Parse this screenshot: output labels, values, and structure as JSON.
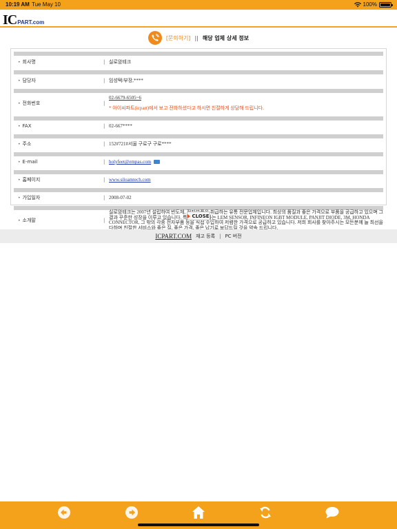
{
  "status_bar": {
    "time": "10:19 AM",
    "date": "Tue May 10",
    "battery": "100%"
  },
  "header": {
    "logo_main": "IC",
    "logo_sub": "PART.com"
  },
  "title": {
    "link": "[문의하기]",
    "separator": "||",
    "main": "해당 업체 상세 정보"
  },
  "info": {
    "company": {
      "label": "회사명",
      "value": "실로암테크"
    },
    "manager": {
      "label": "담당자",
      "value": "임성택/부장,****"
    },
    "phone": {
      "label": "전화번호",
      "value": "02-6679-6505~6",
      "notice": "* 아이씨파트(icpart)에서 보고 전화하셨다고 하시면 친절하게 상담해 드립니다."
    },
    "fax": {
      "label": "FAX",
      "value": "02-667****"
    },
    "address": {
      "label": "주소",
      "value": "152#721#서울 구로구 구로****"
    },
    "email": {
      "label": "E-mail",
      "value": "holyfeet@empas.com"
    },
    "homepage": {
      "label": "홈페이지",
      "value": "www.siloamtech.com"
    },
    "joined": {
      "label": "가입일자",
      "value": "2008-07-02"
    },
    "intro": {
      "label": "소개말",
      "value": "실로암테크는 2007년 설립하여 반도체, 전자부품을 취급하는 유통 전문업체입니다. 최상의 품질과 좋은 가격으로 부품을 공급하고 있으며 그 결과 꾸준한 성장을 이루고 있습니다. 특히 저희 회사는 LEM SENSOR, INFINEON IGBT MODULE, PANJIT DIODE, 3M, HONDA CONNECTOR, 그 밖의 각종 전자부품 등을 직접 수입하여 저렴한 가격으로 공급하고 있습니다. 저희 회사를 찾아주시는 모든분께 늘 최선을 다하며 친절한 서비스와 좋은 질, 좋은 가격, 좋은 납기로 보답드릴 것을 약속 드립니다."
    }
  },
  "close_label": "CLOSE",
  "footer": {
    "brand": "ICPART.COM",
    "link1": "재고 등록",
    "separator": "|",
    "link2": "PC 버전"
  },
  "toolbar": {
    "color": "#f4a21b",
    "icons": [
      "back-arrow-icon",
      "forward-arrow-icon",
      "home-icon",
      "refresh-icon",
      "chat-bubble-icon"
    ]
  }
}
